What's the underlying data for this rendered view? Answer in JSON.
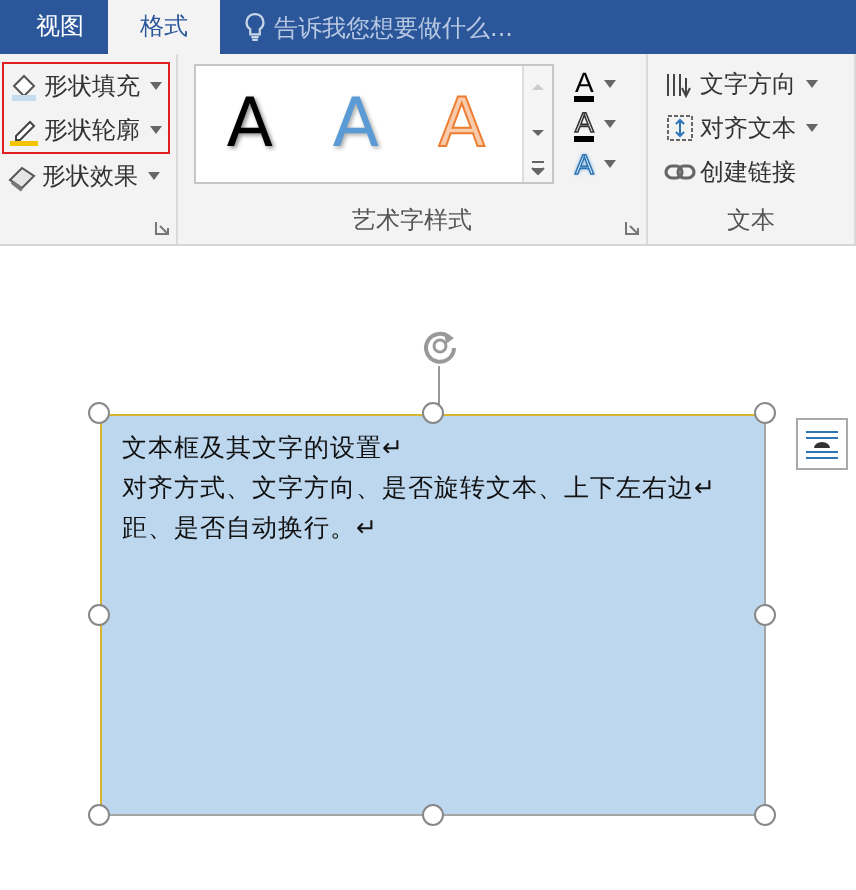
{
  "tabs": [
    {
      "label": "视图",
      "selected": false
    },
    {
      "label": "格式",
      "selected": true
    }
  ],
  "tell_me": {
    "placeholder": "告诉我您想要做什么..."
  },
  "shape_styles": {
    "marked_buttons": [
      {
        "label": "形状填充",
        "kind": "fill"
      },
      {
        "label": "形状轮廓",
        "kind": "outline"
      }
    ],
    "buttons": [
      {
        "label": "形状效果",
        "kind": "effect"
      }
    ]
  },
  "wordart_styles": {
    "label": "艺术字样式",
    "gallery": [
      {
        "letter": "A",
        "kind": "solid"
      },
      {
        "letter": "A",
        "kind": "blue"
      },
      {
        "letter": "A",
        "kind": "outline"
      }
    ],
    "buttons": [
      {
        "letter": "A",
        "kind": "fill"
      },
      {
        "letter": "A",
        "kind": "outline"
      },
      {
        "letter": "A",
        "kind": "effect"
      }
    ]
  },
  "text_group": {
    "label": "文本",
    "buttons": [
      {
        "label": "文字方向",
        "kind": "direction",
        "dropdown": true
      },
      {
        "label": "对齐文本",
        "kind": "align",
        "dropdown": true
      },
      {
        "label": "创建链接",
        "kind": "link",
        "dropdown": false
      }
    ]
  },
  "text_box": {
    "lines": [
      "文本框及其文字的设置↵",
      "对齐方式、文字方向、是否旋转文本、上下左右边↵",
      "距、是否自动换行。↵"
    ]
  }
}
